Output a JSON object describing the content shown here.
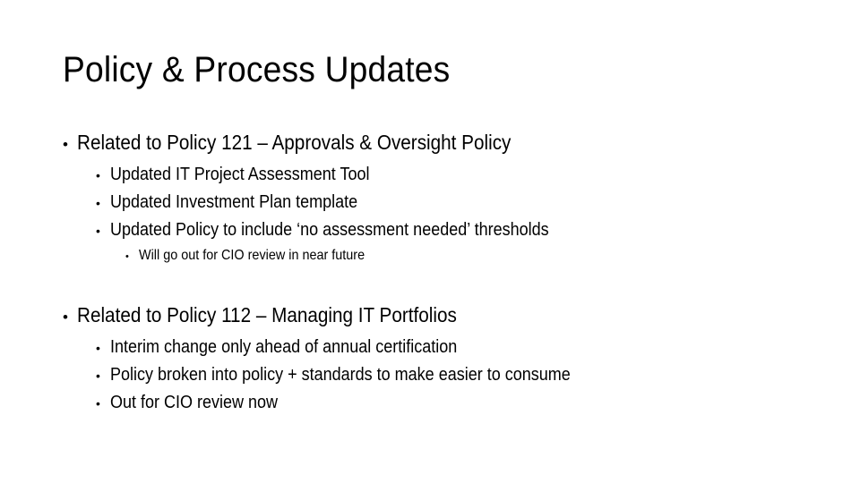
{
  "slide": {
    "title": "Policy & Process Updates",
    "background_color": "#FFFFFF",
    "text_color": "#000000",
    "bullet_glyph": "•",
    "sections": [
      {
        "heading": "Related to Policy 121 – Approvals & Oversight Policy",
        "items": [
          {
            "text": "Updated IT Project Assessment Tool",
            "level": 2
          },
          {
            "text": "Updated Investment Plan template",
            "level": 2
          },
          {
            "text": "Updated Policy to include ‘no assessment needed’ thresholds",
            "level": 2
          },
          {
            "text": "Will go out for CIO review in near future",
            "level": 3
          }
        ]
      },
      {
        "heading": "Related to Policy 112 – Managing IT Portfolios",
        "items": [
          {
            "text": "Interim change only ahead of annual certification",
            "level": 2
          },
          {
            "text": "Policy broken into policy + standards to make easier to consume",
            "level": 2
          },
          {
            "text": "Out for CIO review now",
            "level": 2
          }
        ]
      }
    ]
  }
}
